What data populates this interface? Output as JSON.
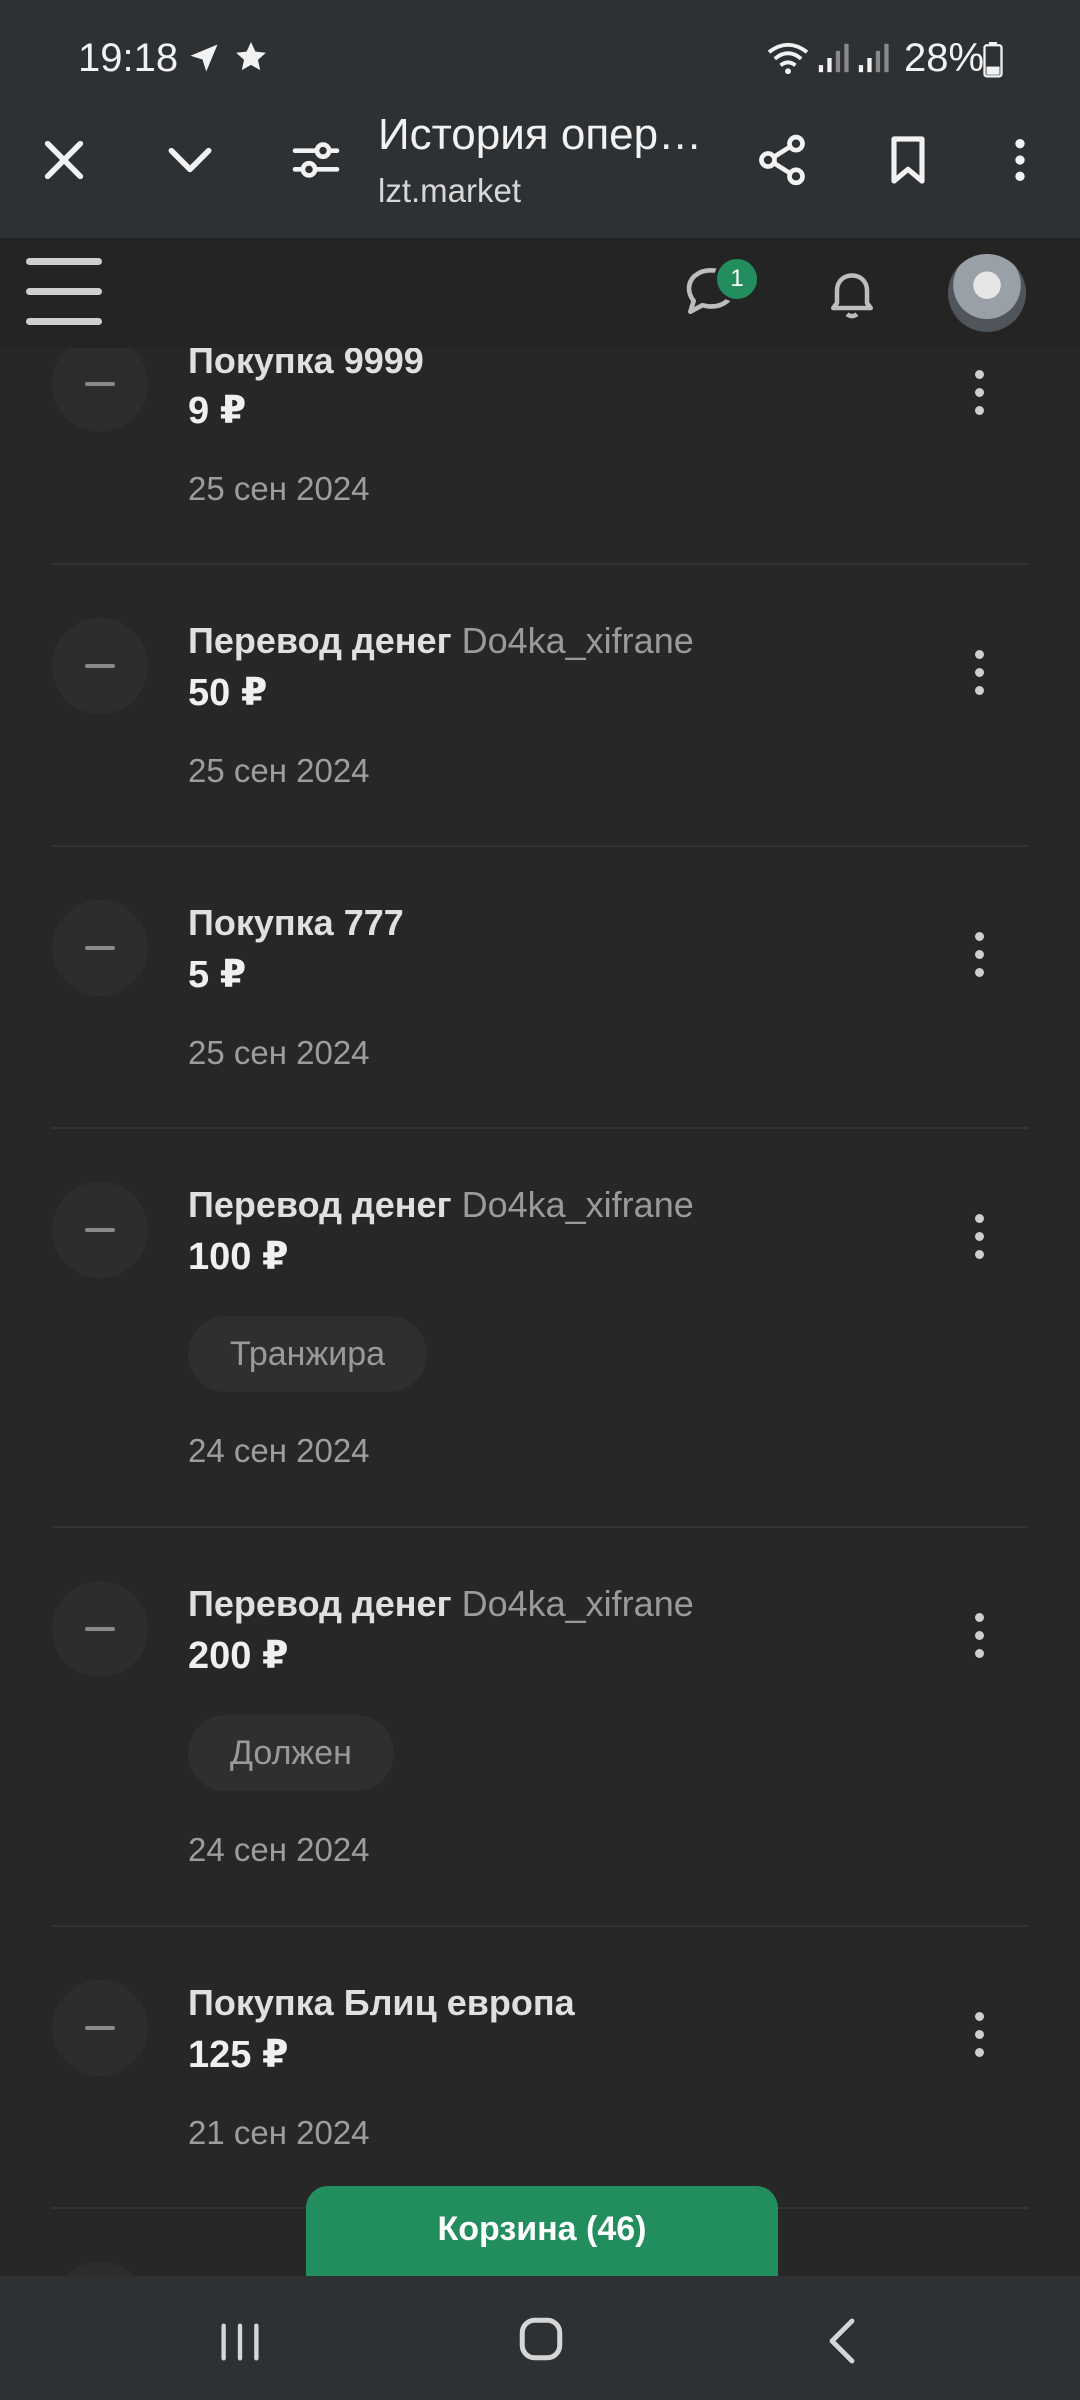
{
  "status_bar": {
    "time": "19:18",
    "battery": "28%",
    "icons": [
      "navigation-arrow-icon",
      "star-icon",
      "wifi-icon",
      "signal-icon",
      "signal-icon",
      "battery-icon"
    ]
  },
  "browser": {
    "title": "История опера...",
    "url": "lzt.market",
    "icons": [
      "close-icon",
      "chevron-down-icon",
      "tune-icon",
      "share-icon",
      "bookmark-icon",
      "more-vertical-icon"
    ]
  },
  "header": {
    "chat_badge": "1",
    "icons": [
      "hamburger-icon",
      "chat-icon",
      "bell-icon",
      "avatar"
    ]
  },
  "operations": [
    {
      "title": "Покупка 9999",
      "user": "",
      "amount": "9 ₽",
      "tag": "",
      "date": "25 сен 2024"
    },
    {
      "title": "Перевод денег",
      "user": "Do4ka_xifrane",
      "amount": "50 ₽",
      "tag": "",
      "date": "25 сен 2024"
    },
    {
      "title": "Покупка 777",
      "user": "",
      "amount": "5 ₽",
      "tag": "",
      "date": "25 сен 2024"
    },
    {
      "title": "Перевод денег",
      "user": "Do4ka_xifrane",
      "amount": "100 ₽",
      "tag": "Транжира",
      "date": "24 сен 2024"
    },
    {
      "title": "Перевод денег",
      "user": "Do4ka_xifrane",
      "amount": "200 ₽",
      "tag": "Должен",
      "date": "24 сен 2024"
    },
    {
      "title": "Покупка Блиц европа",
      "user": "",
      "amount": "125 ₽",
      "tag": "",
      "date": "21 сен 2024"
    }
  ],
  "cart": {
    "label": "Корзина (46)"
  },
  "nav": {
    "icons": [
      "recents-icon",
      "home-icon",
      "back-icon"
    ]
  }
}
